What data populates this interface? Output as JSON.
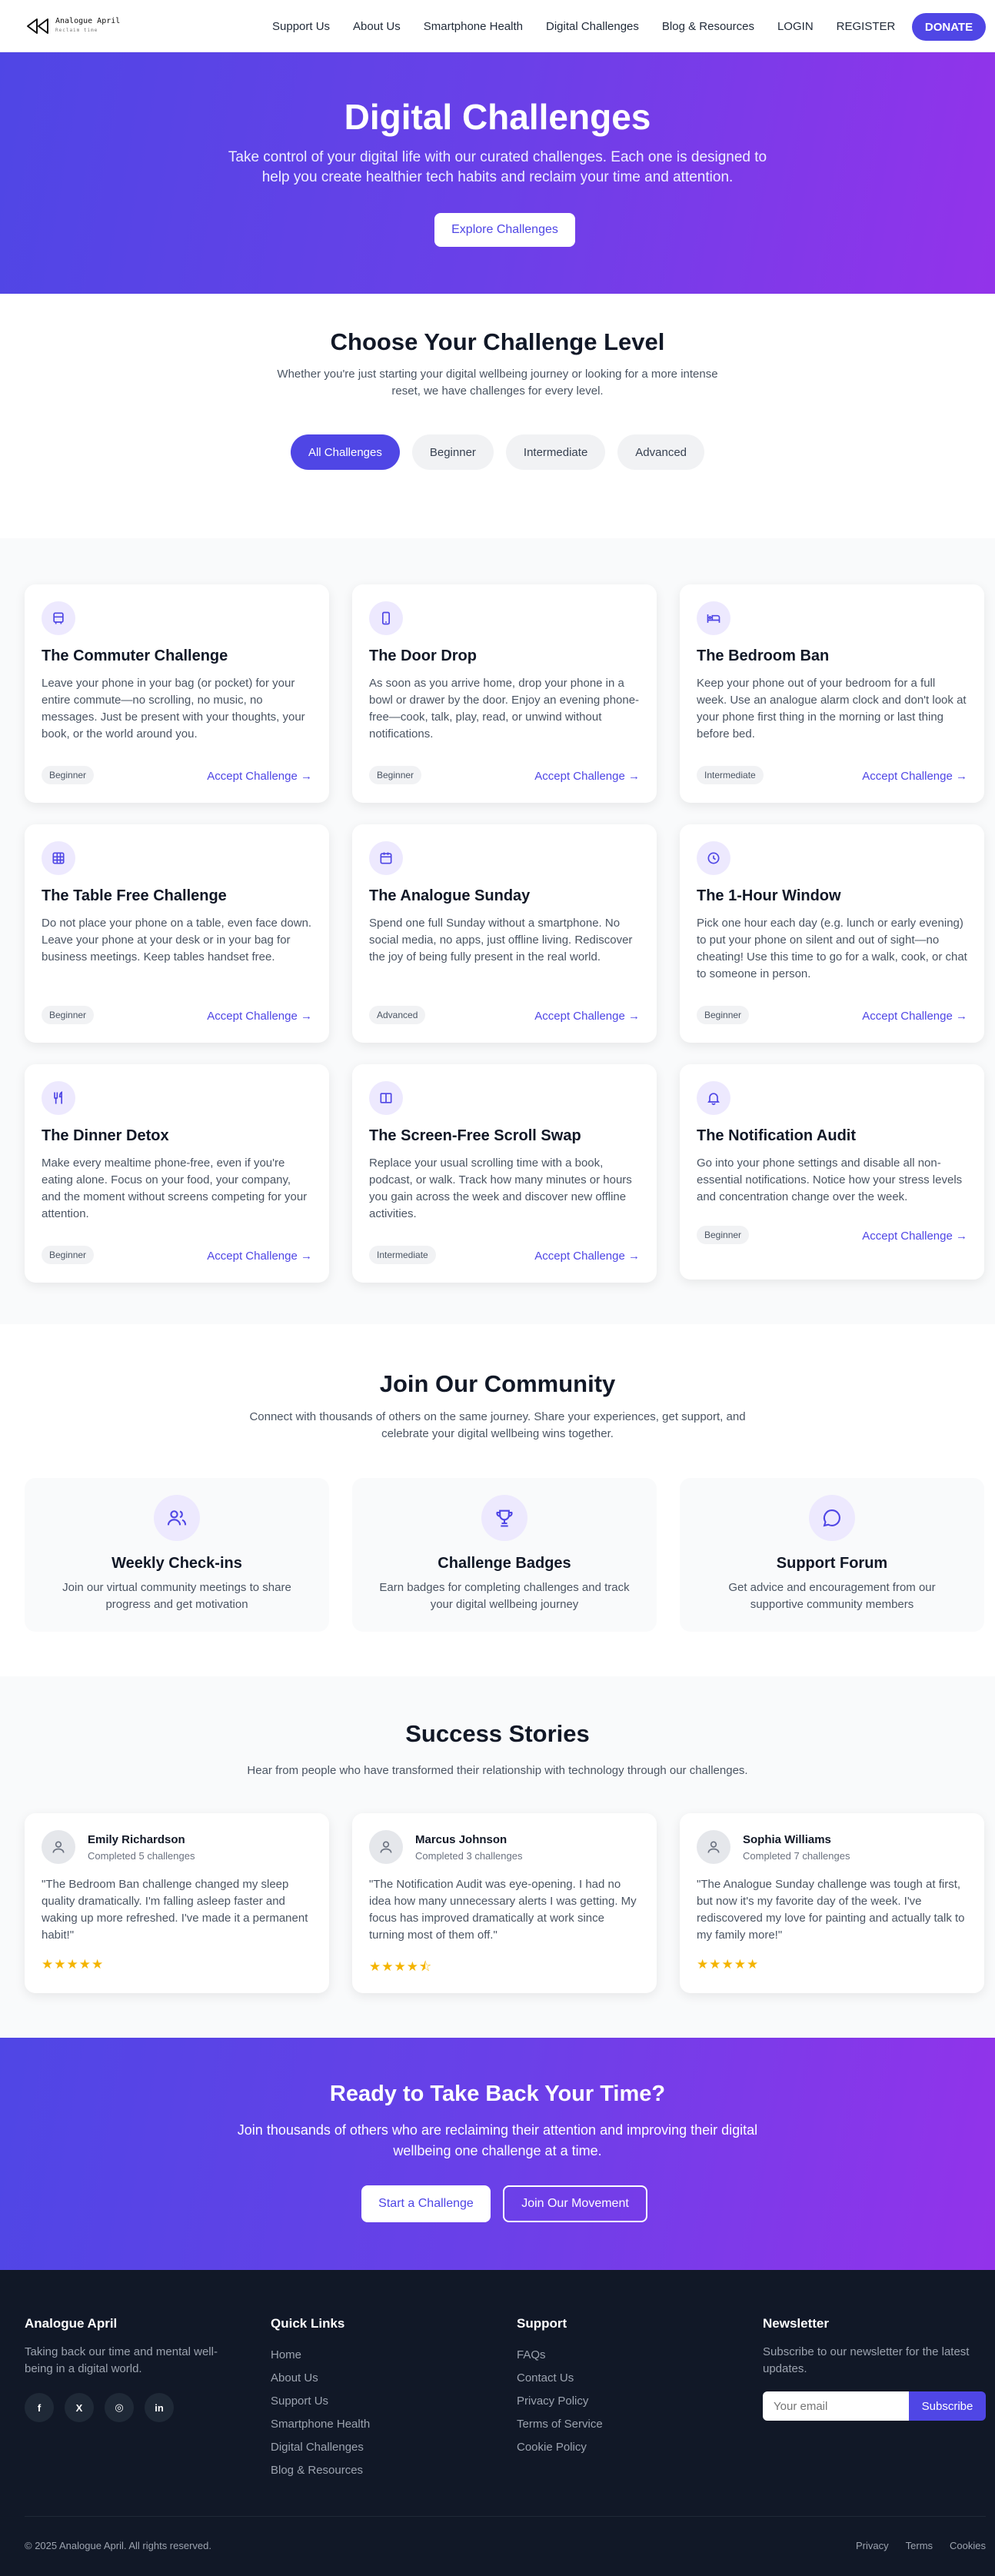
{
  "nav": {
    "logo_name": "Analogue April",
    "logo_sub": "Reclaim time",
    "links": [
      "Support Us",
      "About Us",
      "Smartphone Health",
      "Digital Challenges",
      "Blog & Resources",
      "LOGIN",
      "REGISTER"
    ],
    "donate": "DONATE"
  },
  "hero": {
    "title": "Digital Challenges",
    "subtitle": "Take control of your digital life with our curated challenges. Each one is designed to help you create healthier tech habits and reclaim your time and attention.",
    "button": "Explore Challenges"
  },
  "levels": {
    "title": "Choose Your Challenge Level",
    "subtitle": "Whether you're just starting your digital wellbeing journey or looking for a more intense reset, we have challenges for every level.",
    "filters": [
      "All Challenges",
      "Beginner",
      "Intermediate",
      "Advanced"
    ],
    "active_filter": "All Challenges"
  },
  "challenges": [
    {
      "icon": "bus-icon",
      "title": "The Commuter Challenge",
      "desc": "Leave your phone in your bag (or pocket) for your entire commute—no scrolling, no music, no messages. Just be present with your thoughts, your book, or the world around you.",
      "level": "Beginner",
      "action": "Accept Challenge →"
    },
    {
      "icon": "phone-icon",
      "title": "The Door Drop",
      "desc": "As soon as you arrive home, drop your phone in a bowl or drawer by the door. Enjoy an evening phone-free—cook, talk, play, read, or unwind without notifications.",
      "level": "Beginner",
      "action": "Accept Challenge →"
    },
    {
      "icon": "bed-icon",
      "title": "The Bedroom Ban",
      "desc": "Keep your phone out of your bedroom for a full week. Use an analogue alarm clock and don't look at your phone first thing in the morning or last thing before bed.",
      "level": "Intermediate",
      "action": "Accept Challenge →"
    },
    {
      "icon": "table-icon",
      "title": "The Table Free Challenge",
      "desc": "Do not place your phone on a table, even face down. Leave your phone at your desk or in your bag for business meetings. Keep tables handset free.",
      "level": "Beginner",
      "action": "Accept Challenge →"
    },
    {
      "icon": "calendar-icon",
      "title": "The Analogue Sunday",
      "desc": "Spend one full Sunday without a smartphone. No social media, no apps, just offline living. Rediscover the joy of being fully present in the real world.",
      "level": "Advanced",
      "action": "Accept Challenge →"
    },
    {
      "icon": "clock-icon",
      "title": "The 1-Hour Window",
      "desc": "Pick one hour each day (e.g. lunch or early evening) to put your phone on silent and out of sight—no cheating! Use this time to go for a walk, cook, or chat to someone in person.",
      "level": "Beginner",
      "action": "Accept Challenge →"
    },
    {
      "icon": "utensils-icon",
      "title": "The Dinner Detox",
      "desc": "Make every mealtime phone-free, even if you're eating alone. Focus on your food, your company, and the moment without screens competing for your attention.",
      "level": "Beginner",
      "action": "Accept Challenge →"
    },
    {
      "icon": "book-icon",
      "title": "The Screen-Free Scroll Swap",
      "desc": "Replace your usual scrolling time with a book, podcast, or walk. Track how many minutes or hours you gain across the week and discover new offline activities.",
      "level": "Intermediate",
      "action": "Accept Challenge →"
    },
    {
      "icon": "bell-icon",
      "title": "The Notification Audit",
      "desc": "Go into your phone settings and disable all non-essential notifications. Notice how your stress levels and concentration change over the week.",
      "level": "Beginner",
      "action": "Accept Challenge →"
    }
  ],
  "community": {
    "title": "Join Our Community",
    "subtitle": "Connect with thousands of others on the same journey. Share your experiences, get support, and celebrate your digital wellbeing wins together.",
    "features": [
      {
        "icon": "users-icon",
        "title": "Weekly Check-ins",
        "desc": "Join our virtual community meetings to share progress and get motivation"
      },
      {
        "icon": "trophy-icon",
        "title": "Challenge Badges",
        "desc": "Earn badges for completing challenges and track your digital wellbeing journey"
      },
      {
        "icon": "chat-icon",
        "title": "Support Forum",
        "desc": "Get advice and encouragement from our supportive community members"
      }
    ]
  },
  "stories": {
    "title": "Success Stories",
    "subtitle": "Hear from people who have transformed their relationship with technology through our challenges.",
    "items": [
      {
        "name": "Emily Richardson",
        "meta": "Completed 5 challenges",
        "quote": "\"The Bedroom Ban challenge changed my sleep quality dramatically. I'm falling asleep faster and waking up more refreshed. I've made it a permanent habit!\"",
        "stars": "★★★★★",
        "rating": 5
      },
      {
        "name": "Marcus Johnson",
        "meta": "Completed 3 challenges",
        "quote": "\"The Notification Audit was eye-opening. I had no idea how many unnecessary alerts I was getting. My focus has improved dramatically at work since turning most of them off.\"",
        "stars": "★★★★⯪",
        "rating": 4.5
      },
      {
        "name": "Sophia Williams",
        "meta": "Completed 7 challenges",
        "quote": "\"The Analogue Sunday challenge was tough at first, but now it's my favorite day of the week. I've rediscovered my love for painting and actually talk to my family more!\"",
        "stars": "★★★★★",
        "rating": 5
      }
    ]
  },
  "cta": {
    "title": "Ready to Take Back Your Time?",
    "subtitle": "Join thousands of others who are reclaiming their attention and improving their digital wellbeing one challenge at a time.",
    "primary": "Start a Challenge",
    "secondary": "Join Our Movement"
  },
  "footer": {
    "brand": "Analogue April",
    "desc": "Taking back our time and mental well-being in a digital world.",
    "socials": [
      "f",
      "X",
      "◎",
      "in"
    ],
    "quick_title": "Quick Links",
    "quick_links": [
      "Home",
      "About Us",
      "Support Us",
      "Smartphone Health",
      "Digital Challenges",
      "Blog & Resources"
    ],
    "support_title": "Support",
    "support_links": [
      "FAQs",
      "Contact Us",
      "Privacy Policy",
      "Terms of Service",
      "Cookie Policy"
    ],
    "newsletter_title": "Newsletter",
    "newsletter_desc": "Subscribe to our newsletter for the latest updates.",
    "email_placeholder": "Your email",
    "subscribe": "Subscribe",
    "copyright": "© 2025 Analogue April. All rights reserved.",
    "legal": [
      "Privacy",
      "Terms",
      "Cookies"
    ]
  },
  "colors": {
    "accent": "#4f46e5",
    "gradient_end": "#9333ea",
    "star": "#f4b400",
    "footer_bg": "#111827"
  }
}
